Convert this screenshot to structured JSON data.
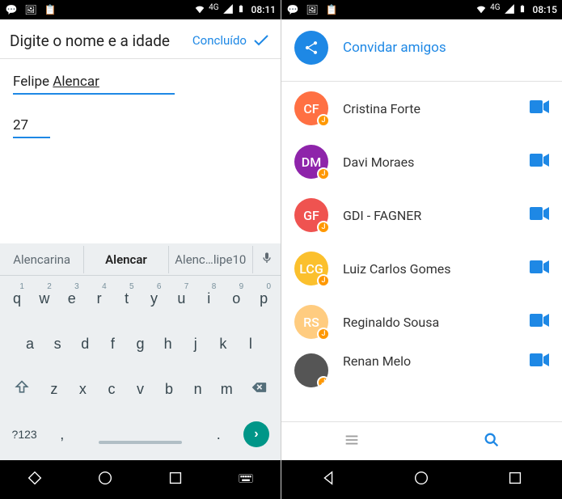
{
  "left": {
    "status": {
      "clock": "08:11",
      "net": "4G"
    },
    "header": {
      "title": "Digite o nome e a idade",
      "done": "Concluído"
    },
    "form": {
      "name_value": "Felipe Alencar",
      "name_first": "Felipe ",
      "name_underlined": "Alencar",
      "age_value": "27"
    },
    "suggestions": [
      "Alencarina",
      "Alencar",
      "Alenc…lipe10"
    ],
    "keys_row1": [
      {
        "k": "q",
        "n": "1"
      },
      {
        "k": "w",
        "n": "2"
      },
      {
        "k": "e",
        "n": "3"
      },
      {
        "k": "r",
        "n": "4"
      },
      {
        "k": "t",
        "n": "5"
      },
      {
        "k": "y",
        "n": "6"
      },
      {
        "k": "u",
        "n": "7"
      },
      {
        "k": "i",
        "n": "8"
      },
      {
        "k": "o",
        "n": "9"
      },
      {
        "k": "p",
        "n": "0"
      }
    ],
    "keys_row2": [
      "a",
      "s",
      "d",
      "f",
      "g",
      "h",
      "j",
      "k",
      "l"
    ],
    "keys_row3": [
      "z",
      "x",
      "c",
      "v",
      "b",
      "n",
      "m"
    ],
    "symbols_key": "?123",
    "comma_key": ",",
    "period_key": "."
  },
  "right": {
    "status": {
      "clock": "08:15",
      "net": "4G"
    },
    "invite_label": "Convidar amigos",
    "contacts": [
      {
        "initials": "CF",
        "name": "Cristina Forte",
        "color": "#ff7043"
      },
      {
        "initials": "DM",
        "name": "Davi Moraes",
        "color": "#8e24aa"
      },
      {
        "initials": "GF",
        "name": "GDI - FAGNER",
        "color": "#ef5350"
      },
      {
        "initials": "LCG",
        "name": "Luiz Carlos Gomes",
        "color": "#fbc02d"
      },
      {
        "initials": "RS",
        "name": "Reginaldo Sousa",
        "color": "#ffcc80"
      },
      {
        "initials": "",
        "name": "Renan Melo",
        "color": "#555",
        "photo": true
      }
    ]
  }
}
